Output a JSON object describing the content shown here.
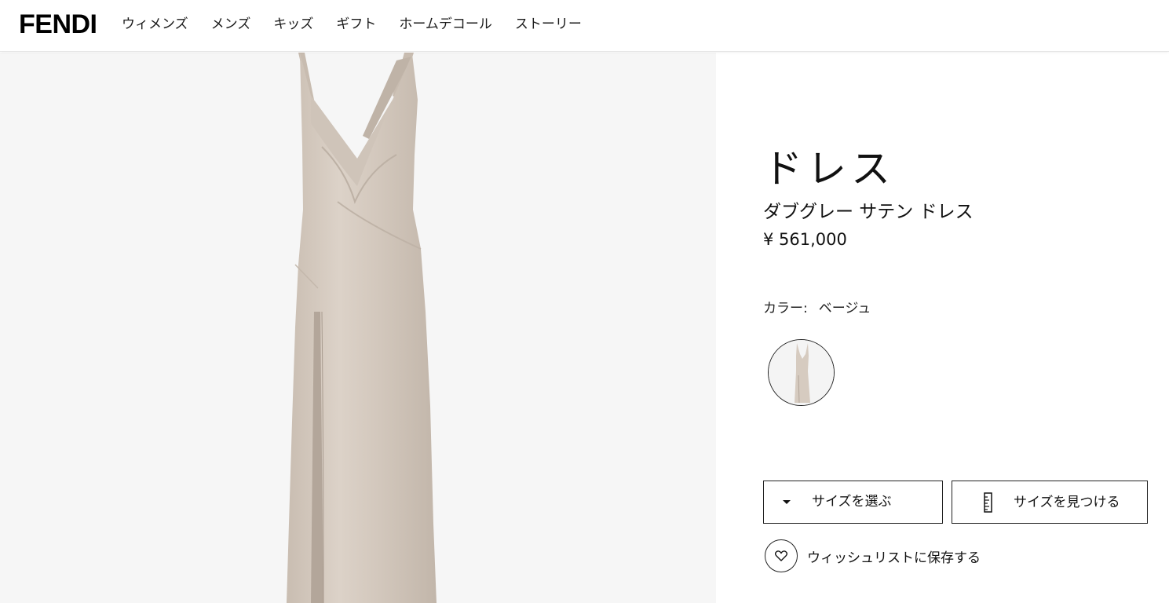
{
  "brand": {
    "logo": "FENDI"
  },
  "nav": {
    "items": [
      {
        "label": "ウィメンズ"
      },
      {
        "label": "メンズ"
      },
      {
        "label": "キッズ"
      },
      {
        "label": "ギフト"
      },
      {
        "label": "ホームデコール"
      },
      {
        "label": "ストーリー"
      }
    ]
  },
  "product": {
    "title": "ドレス",
    "subtitle": "ダブグレー サテン ドレス",
    "price": "¥ 561,000",
    "color_label": "カラー:",
    "color_value": "ベージュ",
    "dress_color": "#d6cbc0"
  },
  "actions": {
    "size_select_label": "サイズを選ぶ",
    "find_size_label": "サイズを見つける",
    "wishlist_label": "ウィッシュリストに保存する"
  },
  "icons": {
    "size_select": "chevron-down-icon",
    "find_size": "ruler-icon",
    "wishlist": "heart-icon"
  }
}
